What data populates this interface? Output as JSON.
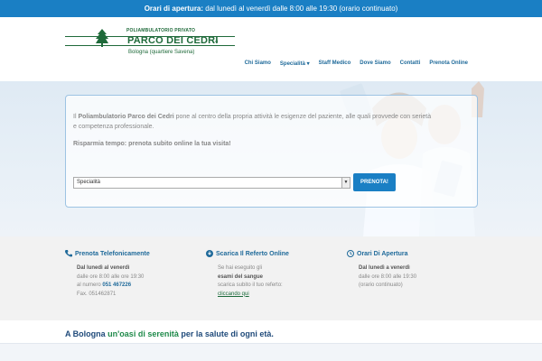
{
  "topbar": {
    "label": "Orari di apertura:",
    "text": "dal lunedì al venerdì dalle 8:00 alle 19:30 (orario continuato)"
  },
  "logo": {
    "tagline": "POLIAMBULATORIO PRIVATO",
    "name": "PARCO DEI CEDRI",
    "suffix": "s.r.l.",
    "location": "Bologna (quartiere Savena)"
  },
  "nav": [
    {
      "label": "Chi Siamo"
    },
    {
      "label": "Specialità ▾"
    },
    {
      "label": "Staff Medico"
    },
    {
      "label": "Dove Siamo"
    },
    {
      "label": "Contatti"
    },
    {
      "label": "Prenota Online"
    }
  ],
  "hero": {
    "intro_pre": "Il ",
    "intro_bold": "Poliambulatorio Parco dei Cedri",
    "intro_post": " pone al centro della propria attività le esigenze del paziente, alle quali provvede con serietà e competenza professionale.",
    "cta": "Risparmia tempo: prenota subito online la tua visita!",
    "select_value": "Specialità",
    "button": "PRENOTA!"
  },
  "info": [
    {
      "title": "Prenota Telefonicamente",
      "icon": "phone-icon",
      "l1": "Dal lunedì al venerdì",
      "l2": "dalle ore 8:00 alle ore 19:30",
      "l3a": "al numero ",
      "l3b": "051 467226",
      "l4": "Fax. 051462871"
    },
    {
      "title": "Scarica Il Referto Online",
      "icon": "download-icon",
      "l1": "Se hai eseguito gli",
      "l2": "esami del sangue",
      "l3": "scarica subito il tuo referto:",
      "l4": "cliccando qui"
    },
    {
      "title": "Orari Di Apertura",
      "icon": "clock-icon",
      "l1": "Dal lunedì a venerdì",
      "l2": "dalle ore 8:00 alle 19:30",
      "l3": "(orario continuato)"
    }
  ],
  "tagline": {
    "a": "A Bologna ",
    "b": "un'oasi di serenità",
    "c": " per la salute di ogni età."
  },
  "colors": {
    "primary": "#1a7fc4",
    "green": "#1f6a3a"
  }
}
